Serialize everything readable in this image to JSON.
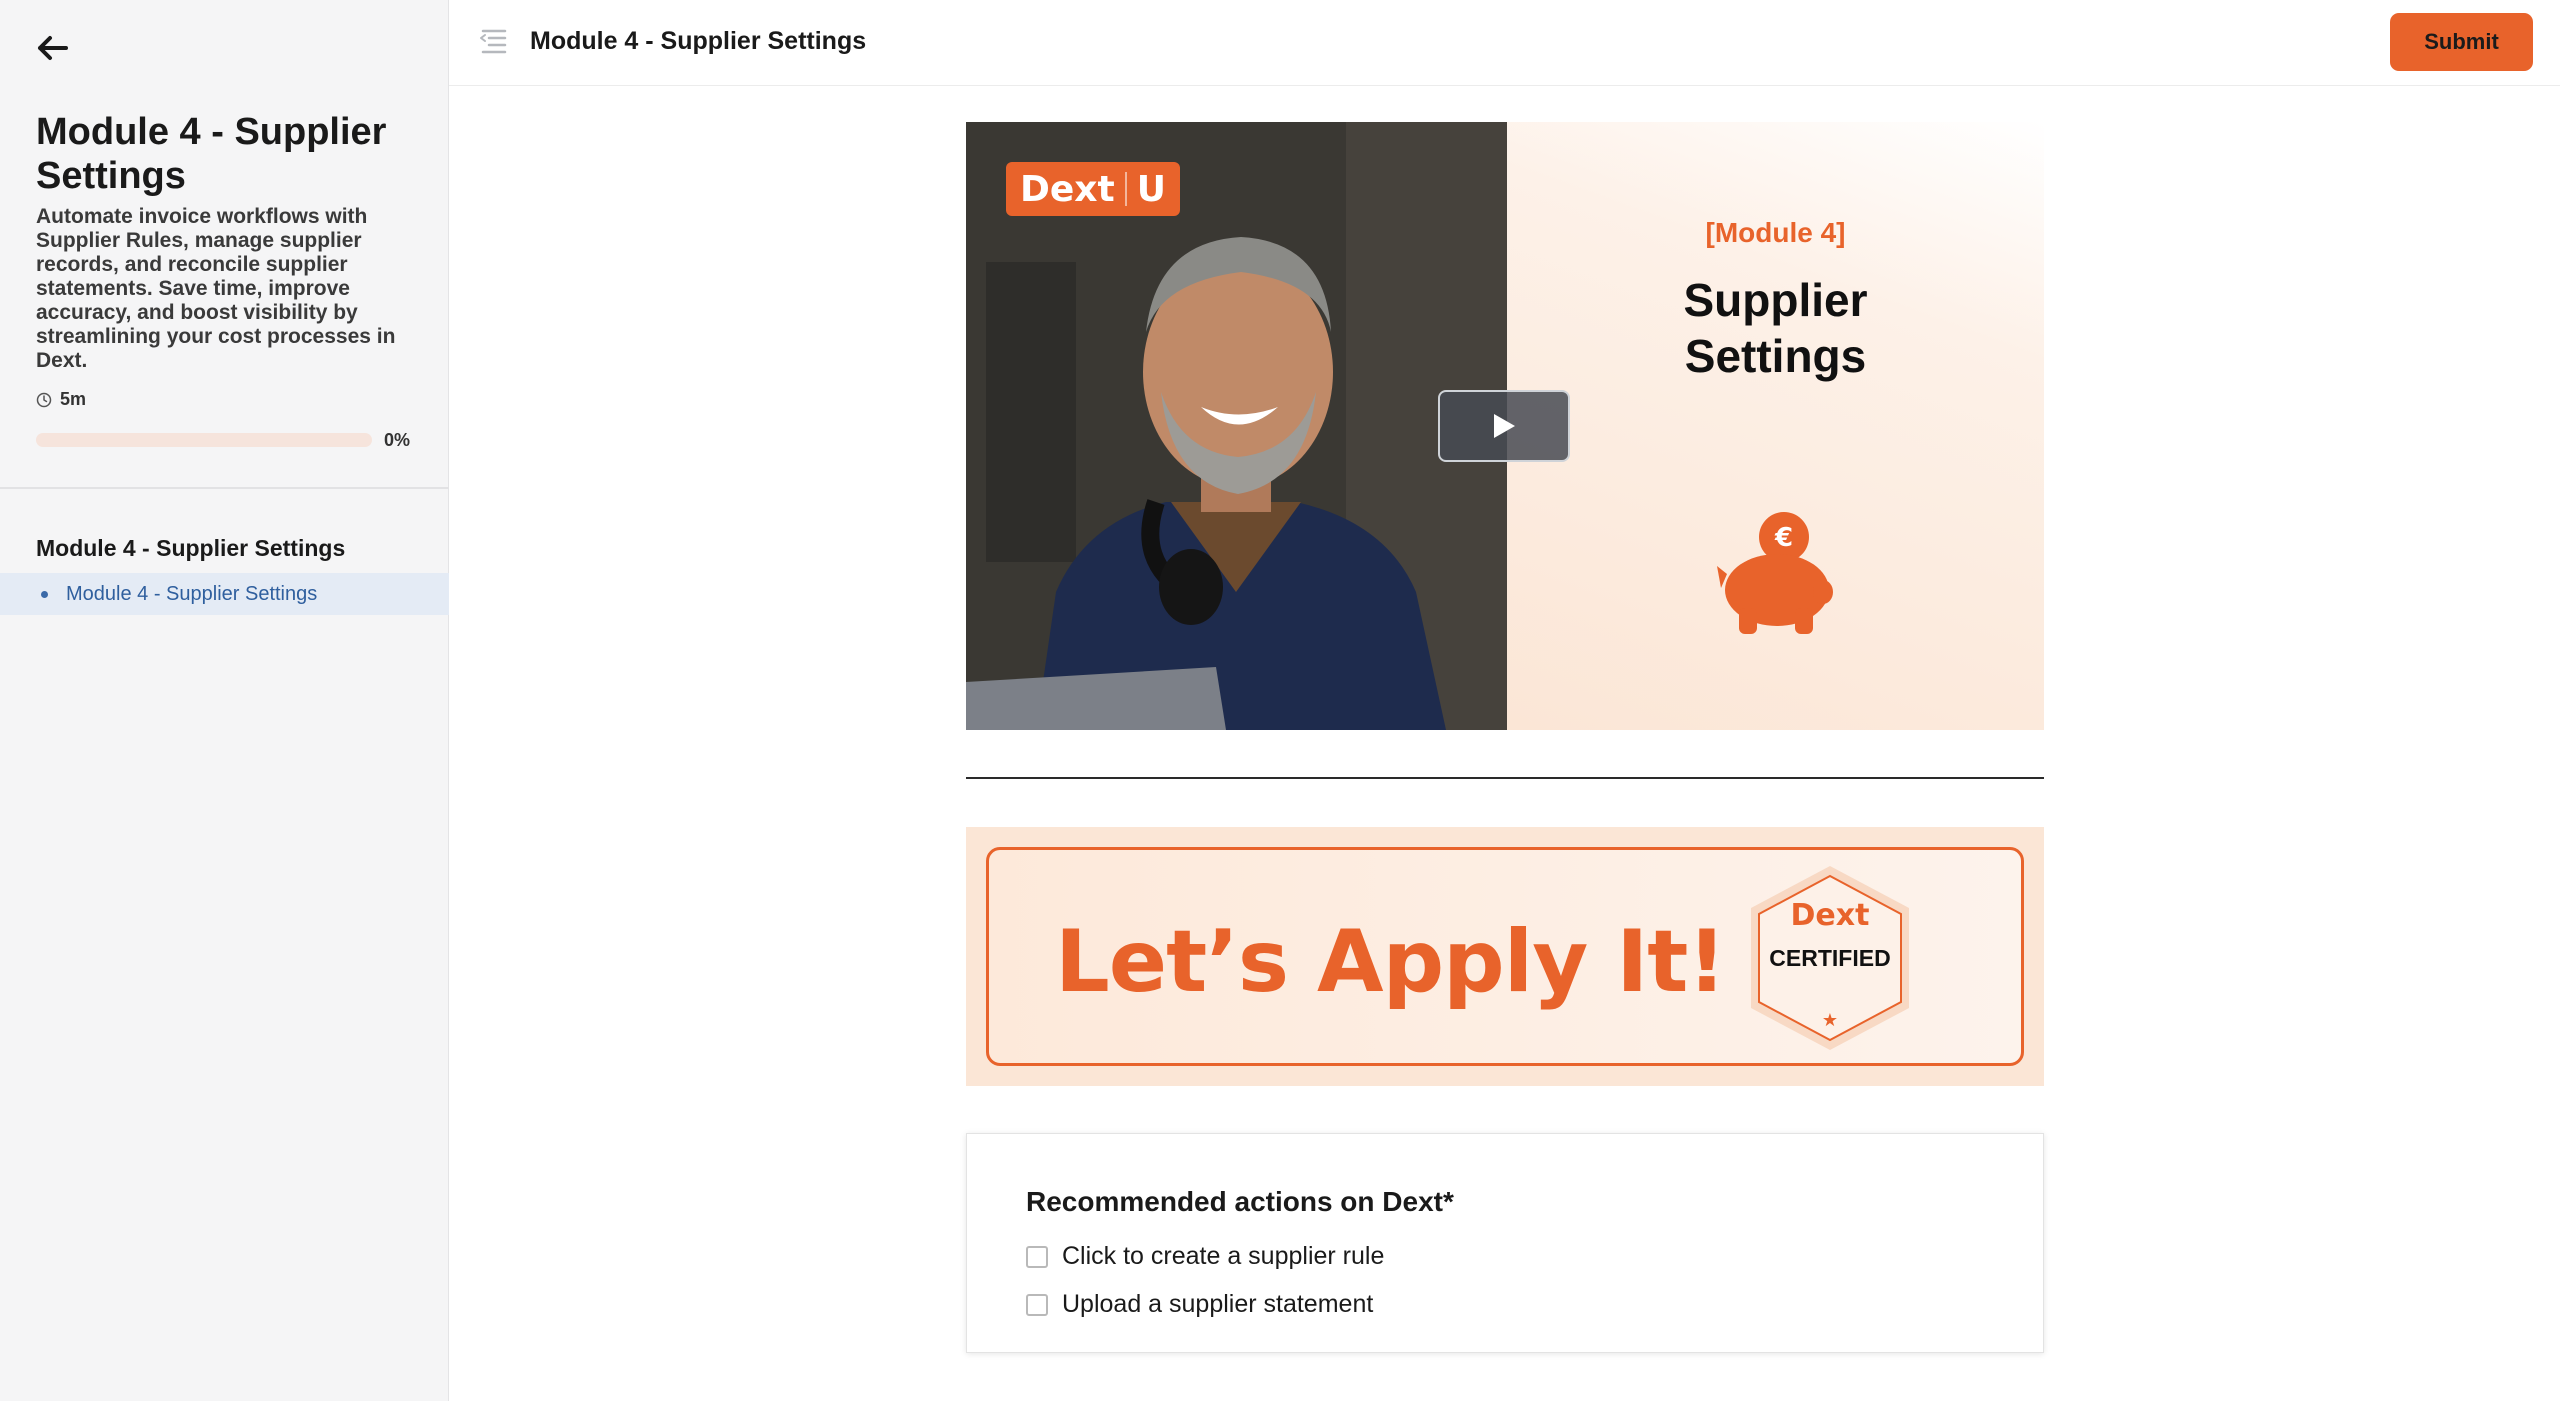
{
  "sidebar": {
    "title": "Module 4 - Supplier Settings",
    "description": "Automate invoice workflows with Supplier Rules, manage supplier records, and reconcile supplier statements. Save time, improve accuracy, and boost visibility by streamlining your cost processes in Dext.",
    "duration": "5m",
    "progress_percent": 0,
    "progress_label": "0%",
    "section_title": "Module 4 - Supplier Settings",
    "items": [
      {
        "label": "Module 4 - Supplier Settings"
      }
    ]
  },
  "topbar": {
    "title": "Module 4 - Supplier Settings",
    "submit_label": "Submit"
  },
  "video": {
    "badge_brand": "Dext",
    "badge_letter": "U",
    "module_tag": "[Module 4]",
    "module_line1": "Supplier",
    "module_line2": "Settings"
  },
  "banner": {
    "heading": "Let’s Apply It!",
    "cert_brand": "Dext",
    "cert_label": "CERTIFIED"
  },
  "actions": {
    "title": "Recommended actions on Dext*",
    "items": [
      {
        "label": "Click to create a supplier rule"
      },
      {
        "label": "Upload a supplier statement"
      }
    ]
  },
  "colors": {
    "accent": "#e8632b",
    "link": "#2f5f9e",
    "sidebar_bg": "#f5f5f6"
  },
  "icons": [
    "back-arrow-icon",
    "toc-icon",
    "clock-icon",
    "play-icon",
    "piggy-bank-icon",
    "euro-icon",
    "star-icon"
  ]
}
